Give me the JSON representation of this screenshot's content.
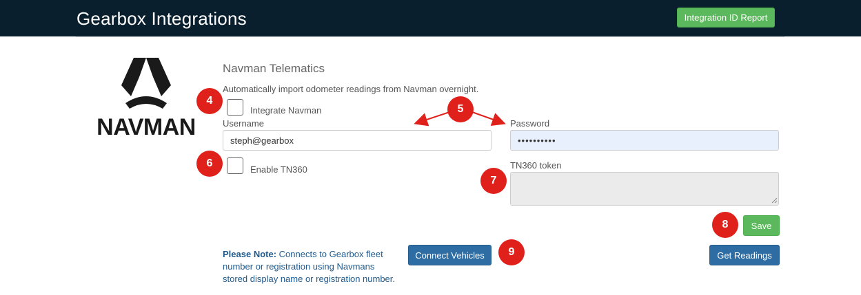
{
  "header": {
    "title": "Gearbox Integrations",
    "report_button": "Integration ID Report"
  },
  "logo": {
    "text": "NAVMAN"
  },
  "section": {
    "title": "Navman Telematics",
    "description": "Automatically import odometer readings from Navman overnight."
  },
  "form": {
    "integrate_label": "Integrate Navman",
    "username_label": "Username",
    "username_value": "steph@gearbox",
    "password_label": "Password",
    "password_value": "••••••••••",
    "tn360_label": "Enable TN360",
    "token_label": "TN360 token",
    "token_value": ""
  },
  "actions": {
    "save": "Save",
    "connect_vehicles": "Connect Vehicles",
    "get_readings": "Get Readings"
  },
  "note": {
    "prefix": "Please Note:",
    "text": " Connects to Gearbox fleet number or registration using Navmans stored display name or registration number."
  },
  "annotations": [
    "4",
    "5",
    "6",
    "7",
    "8",
    "9"
  ],
  "colors": {
    "header_bg": "#0a1f2e",
    "success": "#5cb85c",
    "primary": "#2e6da4",
    "badge": "#e0211b"
  }
}
